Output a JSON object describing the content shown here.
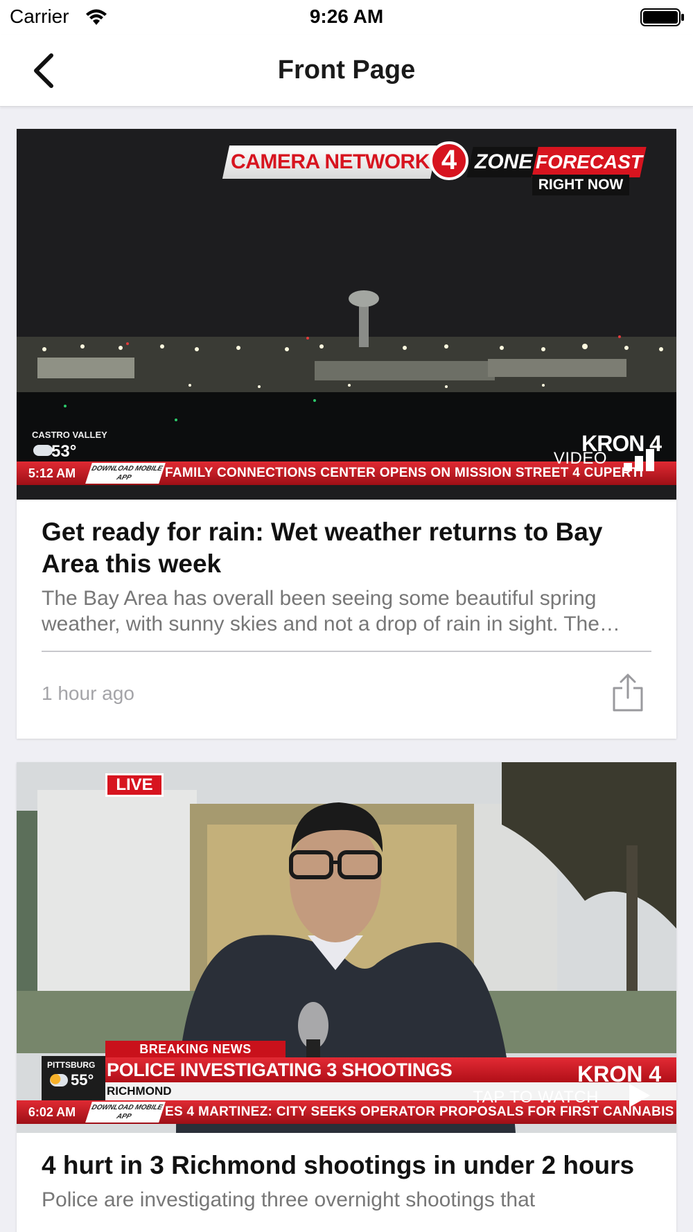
{
  "status_bar": {
    "carrier": "Carrier",
    "time": "9:26 AM"
  },
  "nav": {
    "title": "Front Page",
    "back_icon": "chevron-left-icon"
  },
  "articles": [
    {
      "headline": "Get ready for rain: Wet weather returns to Bay Area this week",
      "summary": "The Bay Area has overall been seeing some beautiful spring weather, with sunny skies and not a drop of rain in sight. The forecast is changing this week.",
      "timestamp": "1 hour ago",
      "media_badge": "VIDEO",
      "broadcast": {
        "bug_left": "CAMERA NETWORK",
        "bug_number": "4",
        "bug_zone": "ZONE",
        "bug_forecast": "FORECAST",
        "bug_right_now": "RIGHT NOW",
        "weather_city": "CASTRO VALLEY",
        "weather_temp": "53°",
        "ticker_time": "5:12 AM",
        "ticker_download": "DOWNLOAD MOBILE APP",
        "ticker_text": "FAMILY CONNECTIONS CENTER OPENS ON MISSION STREET  4  CUPERTI",
        "station": "KRON 4"
      }
    },
    {
      "headline": "4 hurt in 3 Richmond shootings in under 2 hours",
      "summary": "Police are investigating three overnight shootings that",
      "media_badge": "TAP TO WATCH",
      "broadcast": {
        "live": "LIVE",
        "breaking": "BREAKING NEWS",
        "headline": "POLICE INVESTIGATING 3 SHOOTINGS",
        "subline": "RICHMOND",
        "weather_city": "PITTSBURG",
        "weather_temp": "55°",
        "ticker_time": "6:02 AM",
        "ticker_download": "DOWNLOAD MOBILE APP",
        "ticker_text": "ES  4  MARTINEZ: CITY SEEKS OPERATOR PROPOSALS FOR FIRST CANNABIS",
        "station": "KRON 4"
      }
    }
  ],
  "colors": {
    "brand_red": "#d7141f",
    "background": "#efeff4",
    "secondary_text": "#777777",
    "timestamp_text": "#a4a4a8"
  }
}
